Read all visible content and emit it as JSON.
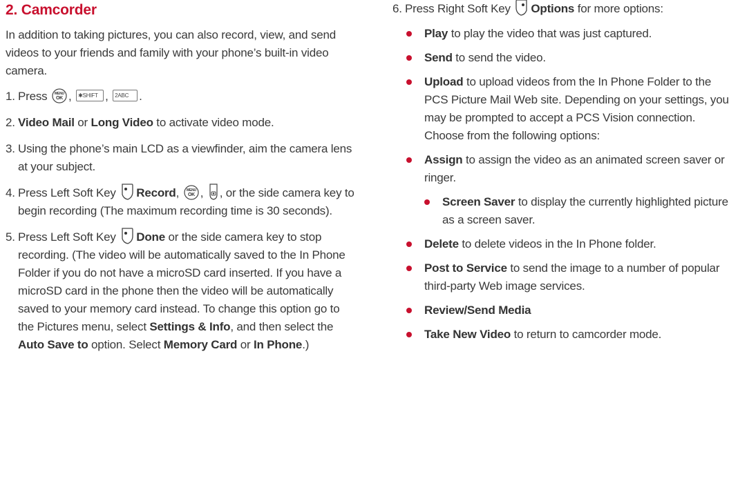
{
  "title": "2. Camcorder",
  "intro": "In addition to taking pictures, you can also record, view, and send videos to your friends and family with your phone’s built-in video camera.",
  "step1": {
    "num": "1.",
    "text": "Press",
    "sep1": ",",
    "sep2": ",",
    "end": ".",
    "key_star": "✱SHIFT",
    "key_2": "2ABC"
  },
  "step2": {
    "num": "2.",
    "b1": "Video Mail",
    "t1": " or ",
    "b2": "Long Video",
    "t2": " to activate video mode."
  },
  "step3": {
    "num": "3.",
    "text": "Using the phone’s main LCD as a viewfinder, aim the camera lens at your subject."
  },
  "step4": {
    "num": "4.",
    "t1": "Press Left Soft Key",
    "b1": "Record",
    "t2": ",",
    "t3": ",",
    "t4": ", or the side camera key to begin recording (The maximum recording time is 30 seconds)."
  },
  "step5": {
    "num": "5.",
    "t1": "Press Left Soft Key",
    "b1": "Done",
    "t2": " or the side camera key to stop recording. (The video will be automatically saved to the In Phone Folder if you do not have a microSD card inserted. If you have a microSD card in the phone then the video will be automatically saved to your memory card instead. To change this option go to the Pictures menu, select ",
    "b2": "Settings & Info",
    "t3": ", and then select the ",
    "b3": "Auto Save to",
    "t4": " option. Select ",
    "b4": "Memory Card",
    "t5": " or ",
    "b5": "In Phone",
    "t6": ".)"
  },
  "step6": {
    "num": "6.",
    "t1": "Press Right Soft Key",
    "b1": "Options",
    "t2": " for more options:"
  },
  "options": [
    {
      "bold": "Play",
      "text": " to play the video that was just captured."
    },
    {
      "bold": "Send",
      "text": " to send the video."
    },
    {
      "bold": "Upload",
      "text": " to upload videos from the In Phone Folder to the PCS Picture Mail Web site. Depending on your settings, you may be prompted to accept a PCS Vision connection. Choose from the following options:"
    },
    {
      "bold": "Assign",
      "text": " to assign the video as an animated screen saver or ringer."
    },
    {
      "bold": "Delete",
      "text": " to delete videos in the In Phone folder."
    },
    {
      "bold": "Post to Service",
      "text": " to send the image to a number of popular third-party Web image services."
    },
    {
      "bold": "Review/Send Media",
      "text": ""
    },
    {
      "bold": "Take New Video",
      "text": "  to return to camcorder mode."
    }
  ],
  "sub_options": [
    {
      "bold": "Screen Saver",
      "text": " to display the currently highlighted picture as a screen saver."
    }
  ],
  "icons": [
    "menu-ok-key-icon",
    "star-shift-key-icon",
    "2abc-key-icon",
    "left-soft-key-icon",
    "right-soft-key-icon",
    "camera-key-icon"
  ],
  "colors": {
    "heading": "#c8102e",
    "bullet": "#c8102e",
    "text": "#3a3a3a"
  }
}
